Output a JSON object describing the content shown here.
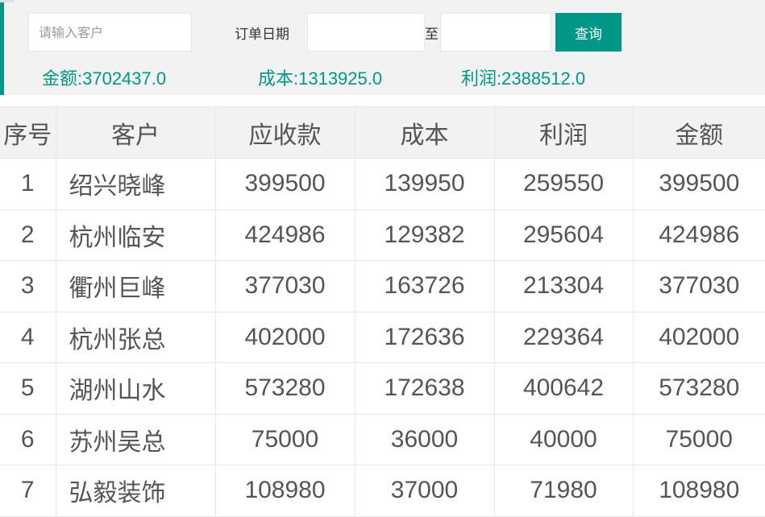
{
  "filters": {
    "customer_placeholder": "请输入客户",
    "customer_value": "",
    "date_label": "订单日期",
    "date_separator": "至",
    "date_start_value": "",
    "date_end_value": "",
    "query_label": "查询"
  },
  "summary": {
    "amount": "金额:3702437.0",
    "cost": "成本:1313925.0",
    "profit": "利润:2388512.0"
  },
  "table": {
    "headers": [
      "序号",
      "客户",
      "应收款",
      "成本",
      "利润",
      "金额"
    ],
    "rows": [
      [
        "1",
        "绍兴晓峰",
        "399500",
        "139950",
        "259550",
        "399500"
      ],
      [
        "2",
        "杭州临安",
        "424986",
        "129382",
        "295604",
        "424986"
      ],
      [
        "3",
        "衢州巨峰",
        "377030",
        "163726",
        "213304",
        "377030"
      ],
      [
        "4",
        "杭州张总",
        "402000",
        "172636",
        "229364",
        "402000"
      ],
      [
        "5",
        "湖州山水",
        "573280",
        "172638",
        "400642",
        "573280"
      ],
      [
        "6",
        "苏州吴总",
        "75000",
        "36000",
        "40000",
        "75000"
      ],
      [
        "7",
        "弘毅装饰",
        "108980",
        "37000",
        "71980",
        "108980"
      ]
    ]
  },
  "colors": {
    "accent": "#009688",
    "panel_background": "#f2f2f2",
    "border": "#e6e6e6"
  }
}
